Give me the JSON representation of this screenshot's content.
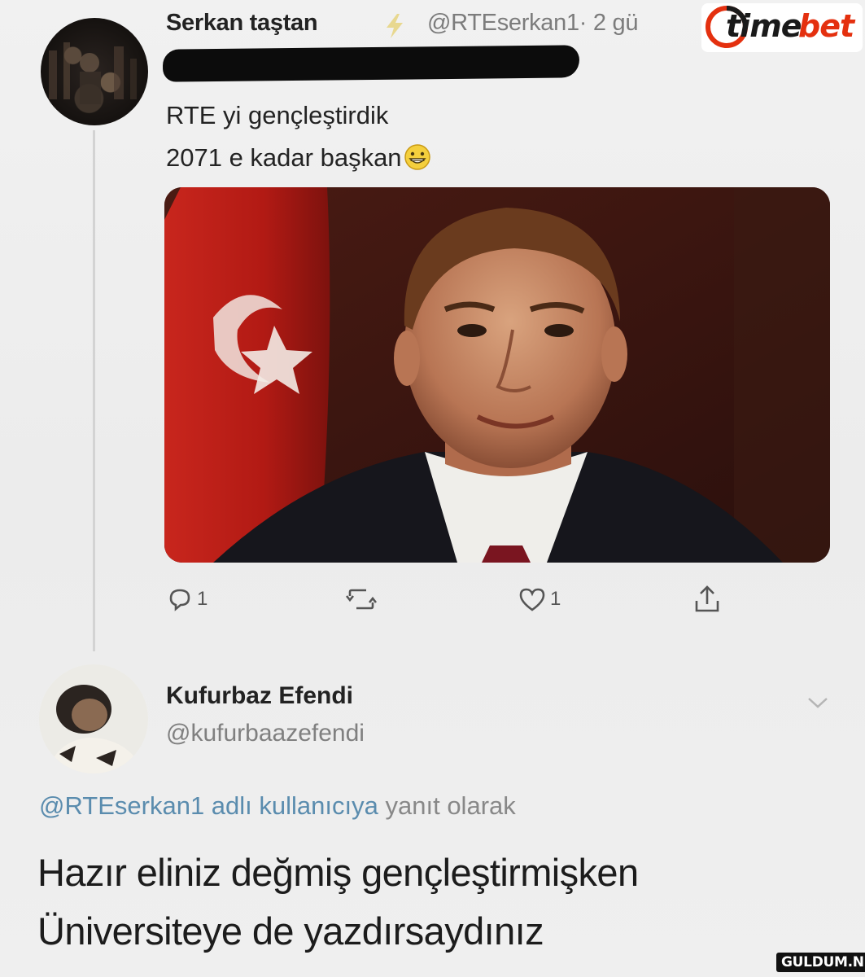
{
  "tweet": {
    "author_name": "Serkan taştan",
    "handle": "@RTEserkan1",
    "time_separator": "·",
    "time": "2 gü",
    "text_lines": [
      "RTE yi gençleştirdik",
      "2071 e kadar başkan"
    ],
    "emoji": "grinning-face-icon",
    "actions": {
      "reply_count": "1",
      "like_count": "1"
    }
  },
  "reply": {
    "author_name": "Kufurbaz Efendi",
    "handle": "@kufurbaazefendi",
    "reply_to_mention": "@RTEserkan1 adlı kullanıcıya",
    "reply_to_rest": "yanıt olarak",
    "text_lines": [
      "Hazır eliniz değmiş gençleştirmişken",
      "Üniversiteye de yazdırsaydınız"
    ]
  },
  "branding": {
    "logo_part1": "time",
    "logo_part2": "bet",
    "logo_accent_color": "#e4300f",
    "watermark": "GULDUM.NET"
  },
  "colors": {
    "mention": "#5a8cae",
    "secondary_text": "#7c7c7c",
    "verified_bolt": "#e8d890"
  }
}
